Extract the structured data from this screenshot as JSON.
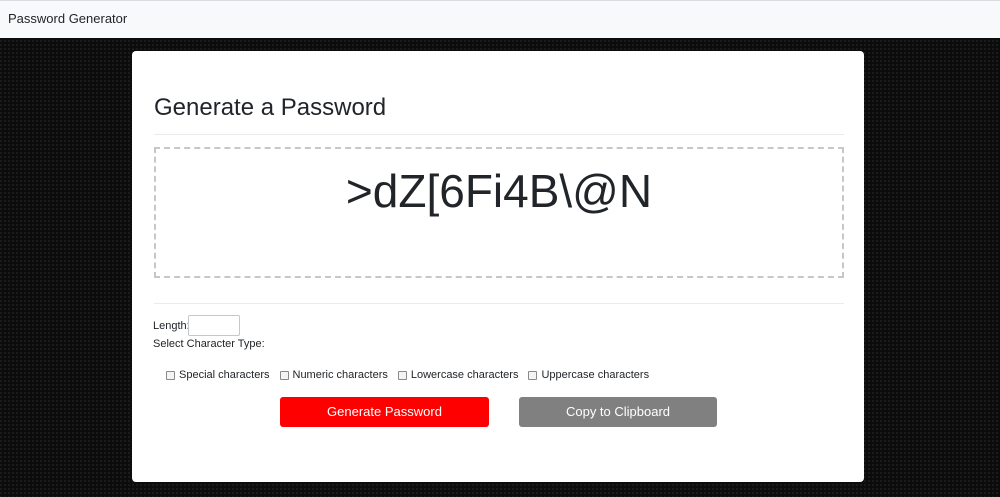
{
  "navbar": {
    "brand": "Password Generator"
  },
  "card": {
    "title": "Generate a Password",
    "password": ">dZ[6Fi4B\\@N"
  },
  "form": {
    "length_label": "Length:",
    "length_value": "",
    "char_type_label": "Select Character Type:",
    "options": [
      {
        "label": "Special characters",
        "checked": false
      },
      {
        "label": "Numeric characters",
        "checked": false
      },
      {
        "label": "Lowercase characters",
        "checked": false
      },
      {
        "label": "Uppercase characters",
        "checked": false
      }
    ]
  },
  "buttons": {
    "generate_label": "Generate Password",
    "copy_label": "Copy to Clipboard"
  },
  "colors": {
    "generate_button": "#ff0000",
    "copy_button": "#808080",
    "navbar_background": "#f8f9fa",
    "page_background": "#0c0c0c"
  }
}
